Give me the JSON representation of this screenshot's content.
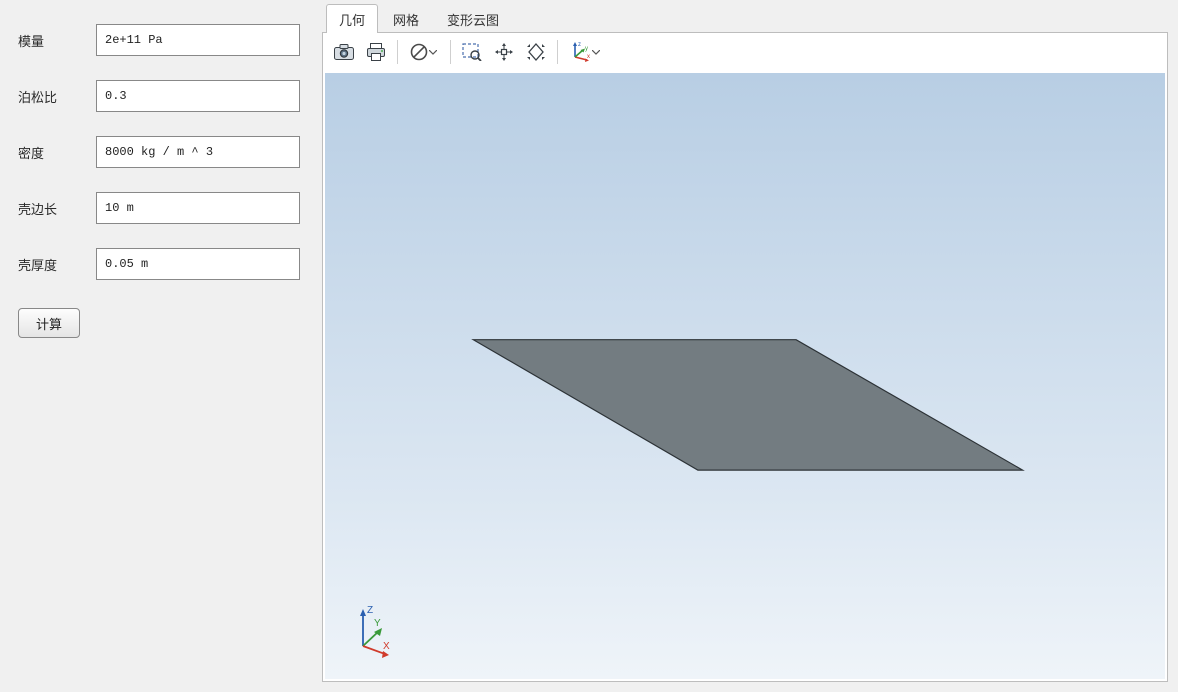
{
  "form": {
    "fields": [
      {
        "label": "模量",
        "value": "2e+11 Pa"
      },
      {
        "label": "泊松比",
        "value": "0.3"
      },
      {
        "label": "密度",
        "value": "8000 kg / m ^ 3"
      },
      {
        "label": "壳边长",
        "value": "10 m"
      },
      {
        "label": "壳厚度",
        "value": "0.05 m"
      }
    ],
    "compute_label": "计算"
  },
  "tabs": [
    {
      "label": "几何",
      "active": true
    },
    {
      "label": "网格",
      "active": false
    },
    {
      "label": "变形云图",
      "active": false
    }
  ],
  "toolbar_icons": {
    "snapshot": "snapshot-icon",
    "print": "print-icon",
    "no_entry": "no-entry-icon",
    "zoom_box": "zoom-box-icon",
    "pan": "pan-icon",
    "fit": "fit-icon",
    "axes": "axes-icon"
  },
  "triad_labels": {
    "x": "X",
    "y": "Y",
    "z": "Z"
  },
  "colors": {
    "plate_fill": "#737c81",
    "plate_edge": "#2c3236",
    "axis_x": "#d03a2b",
    "axis_y": "#3a9a3a",
    "axis_z": "#2a5fb0"
  }
}
